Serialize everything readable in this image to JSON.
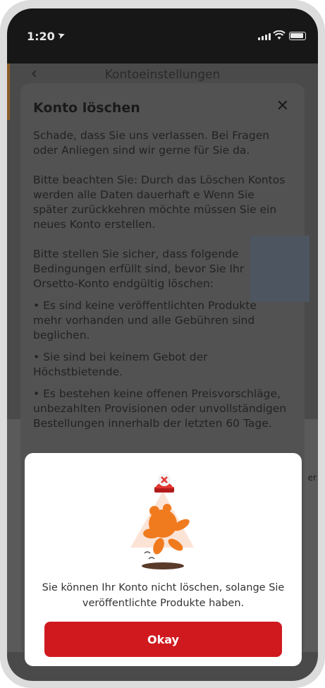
{
  "status_bar": {
    "time": "1:20"
  },
  "page": {
    "nav_title": "Kontoeinstellungen",
    "back_glyph": "‹"
  },
  "sheet": {
    "title": "Konto löschen",
    "close_glyph": "✕",
    "paragraph_1": "Schade, dass Sie uns verlassen. Bei Fragen oder Anliegen sind wir gerne für Sie da.",
    "paragraph_2": "Bitte beachten Sie: Durch das Löschen Kontos werden alle Daten dauerhaft e Wenn Sie später zurückkehren möchte müssen Sie ein neues Konto erstellen.",
    "paragraph_3": "Bitte stellen Sie sicher, dass folgende Bedingungen erfüllt sind, bevor Sie Ihr Orsetto-Konto endgültig löschen:",
    "bullets": [
      "• Es sind keine veröffentlichten Produkte mehr vorhanden und alle Gebühren sind beglichen.",
      "• Sie sind bei keinem Gebot der Höchstbietende.",
      "• Es bestehen keine offenen Preisvorschläge, unbezahlten Provisionen oder unvollständigen Bestellungen innerhalb der letzten 60 Tage."
    ],
    "side_fragment": "er"
  },
  "dialog": {
    "message": "Sie können Ihr Konto nicht löschen, solange Sie veröffentlichte Produkte haben.",
    "okay_label": "Okay"
  },
  "colors": {
    "accent": "#d0191f",
    "bear": "#f07a1e",
    "overlay": "#171717"
  }
}
